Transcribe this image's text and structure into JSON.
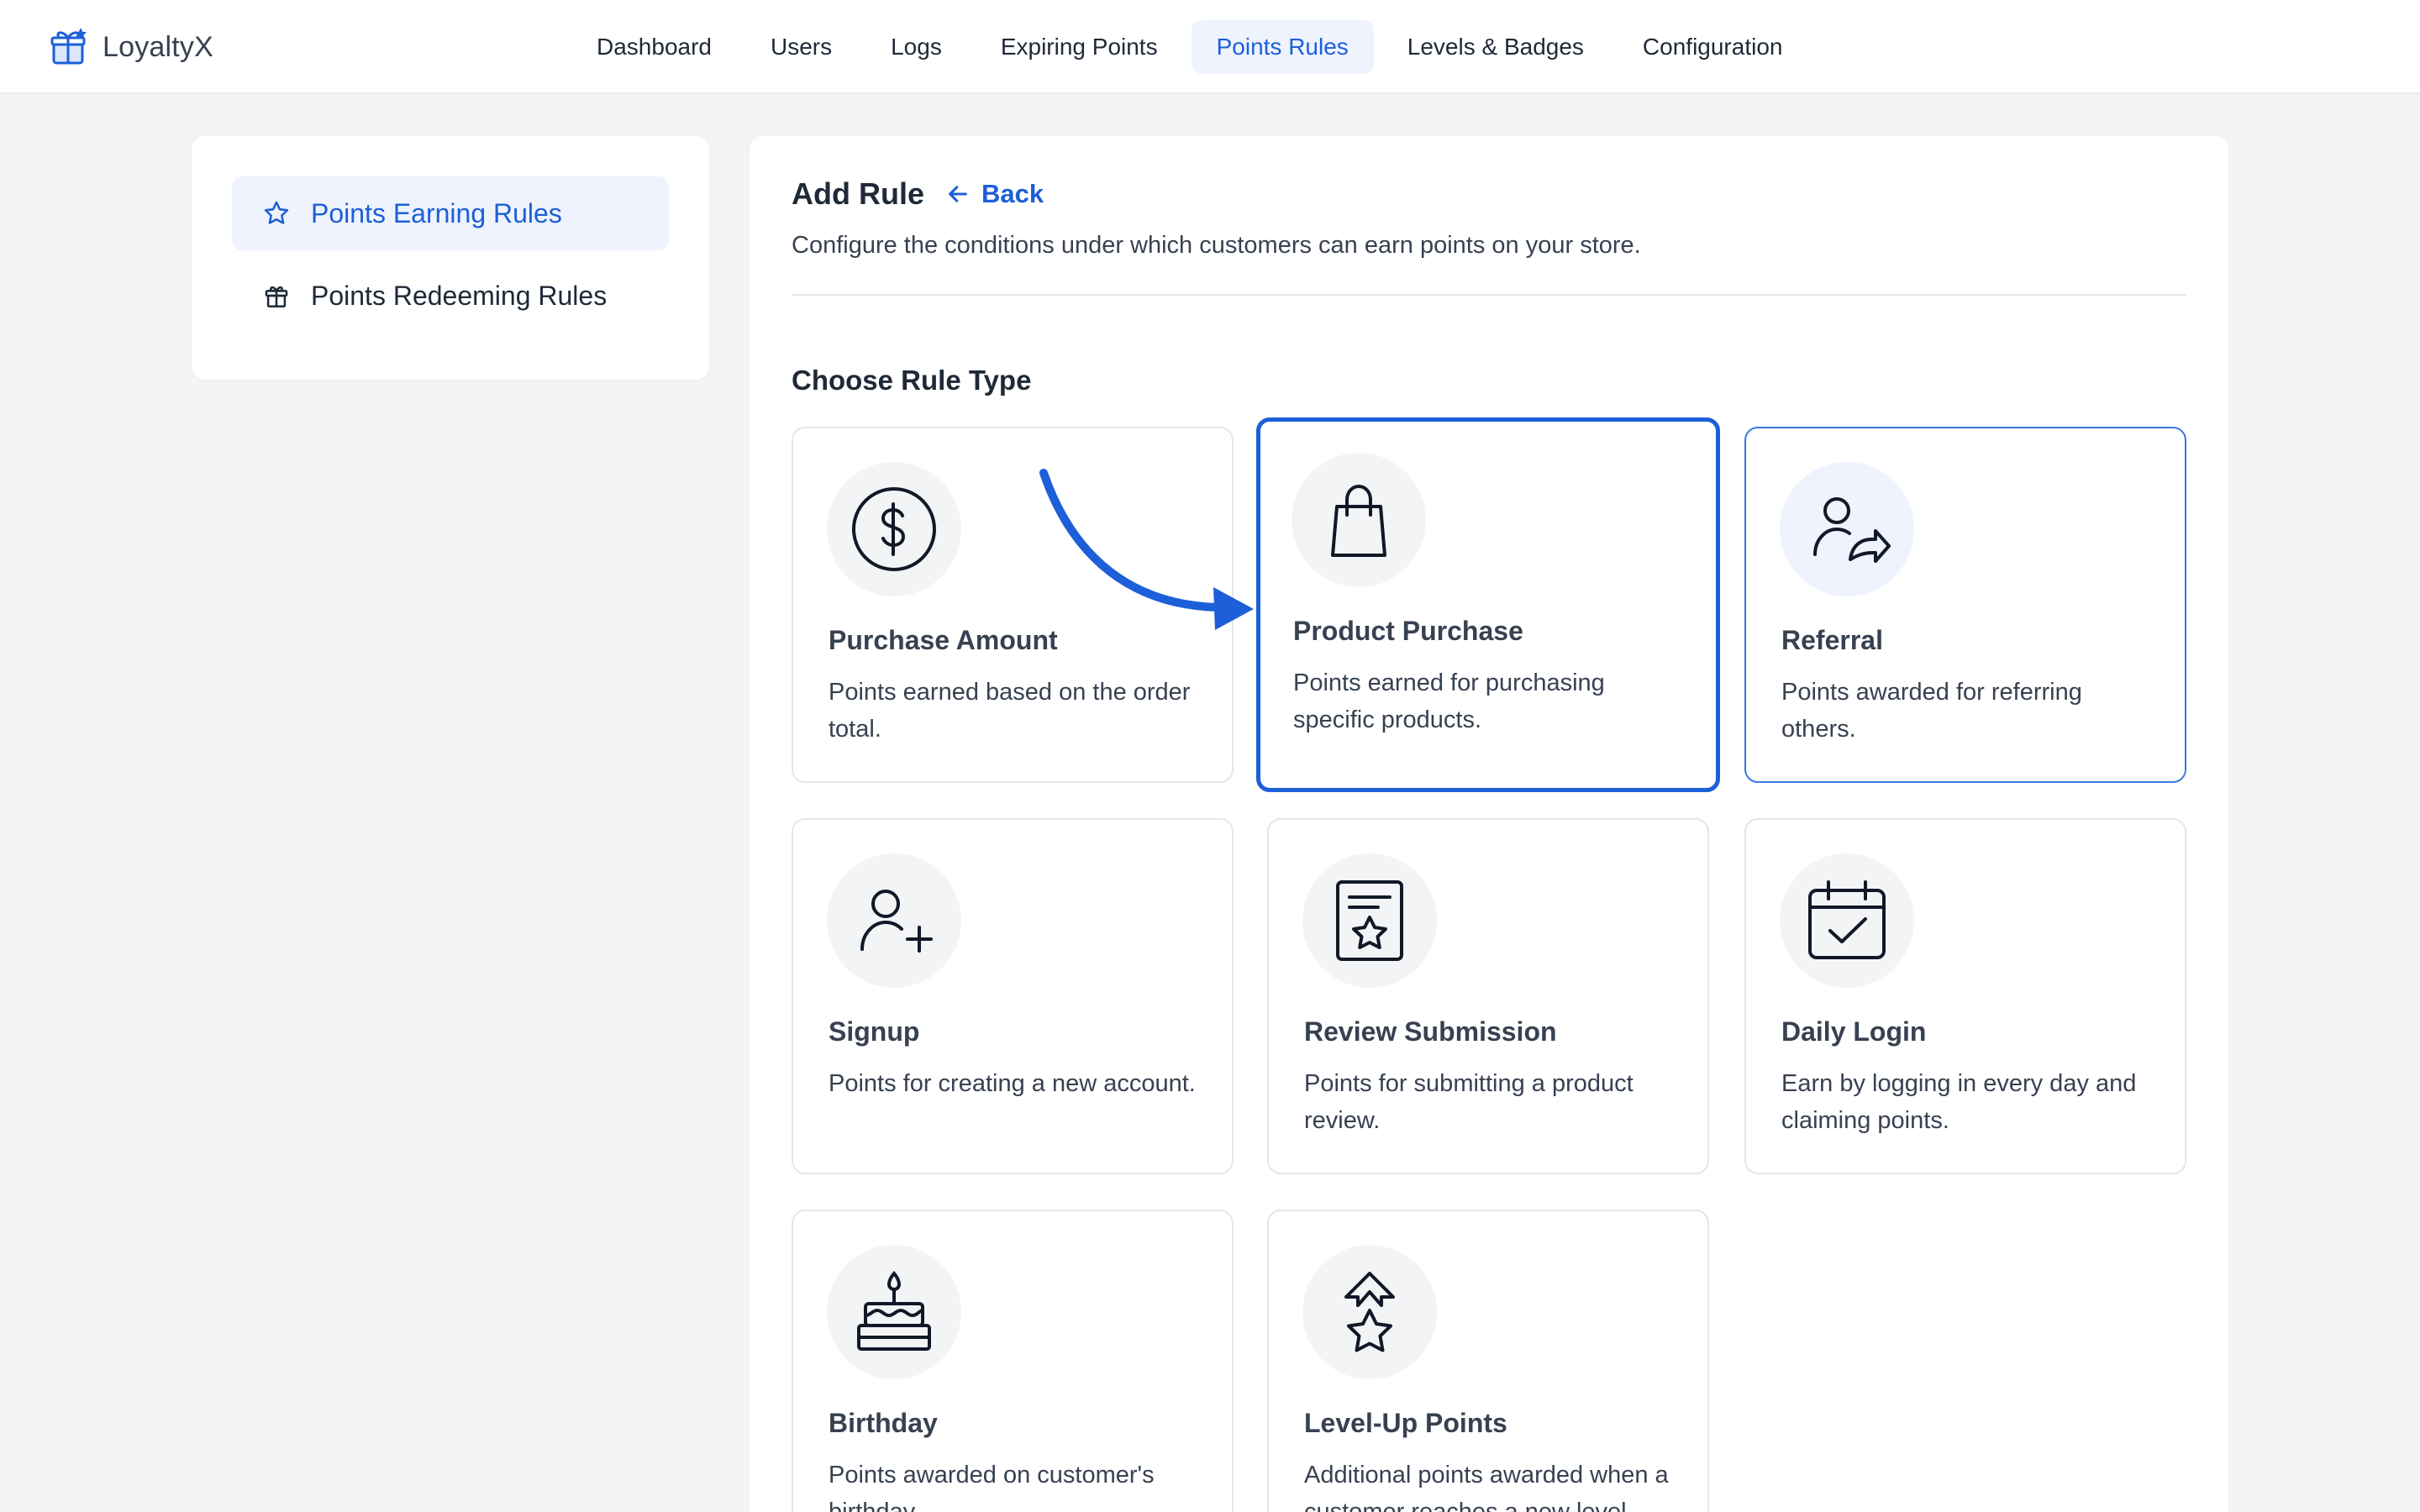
{
  "app": {
    "name": "LoyaltyX"
  },
  "nav": {
    "items": [
      {
        "label": "Dashboard"
      },
      {
        "label": "Users"
      },
      {
        "label": "Logs"
      },
      {
        "label": "Expiring Points"
      },
      {
        "label": "Points Rules"
      },
      {
        "label": "Levels & Badges"
      },
      {
        "label": "Configuration"
      }
    ],
    "active": "Points Rules"
  },
  "sidebar": {
    "items": [
      {
        "label": "Points Earning Rules",
        "icon": "star-icon",
        "active": true
      },
      {
        "label": "Points Redeeming Rules",
        "icon": "gift-icon",
        "active": false
      }
    ]
  },
  "main": {
    "title": "Add Rule",
    "back_label": "Back",
    "subtitle": "Configure the conditions under which customers can earn points on your store.",
    "section_title": "Choose Rule Type",
    "cards": [
      {
        "title": "Purchase Amount",
        "description": "Points earned based on the order total.",
        "icon": "dollar-coin-icon"
      },
      {
        "title": "Product Purchase",
        "description": "Points earned for purchasing specific products.",
        "icon": "shopping-bag-icon",
        "selected": true
      },
      {
        "title": "Referral",
        "description": "Points awarded for referring others.",
        "icon": "user-share-icon",
        "hovered": true
      },
      {
        "title": "Signup",
        "description": "Points for creating a new account.",
        "icon": "user-plus-icon"
      },
      {
        "title": "Review Submission",
        "description": "Points for submitting a product review.",
        "icon": "review-star-icon"
      },
      {
        "title": "Daily Login",
        "description": "Earn by logging in every day and claiming points.",
        "icon": "calendar-check-icon"
      },
      {
        "title": "Birthday",
        "description": "Points awarded on customer's birthday.",
        "icon": "birthday-cake-icon"
      },
      {
        "title": "Level-Up Points",
        "description": "Additional points awarded when a customer reaches a new level.",
        "icon": "level-up-star-icon"
      }
    ]
  },
  "colors": {
    "accent": "#1d5fd8",
    "active_bg": "#eef3fd",
    "page_bg": "#f3f4f6"
  }
}
